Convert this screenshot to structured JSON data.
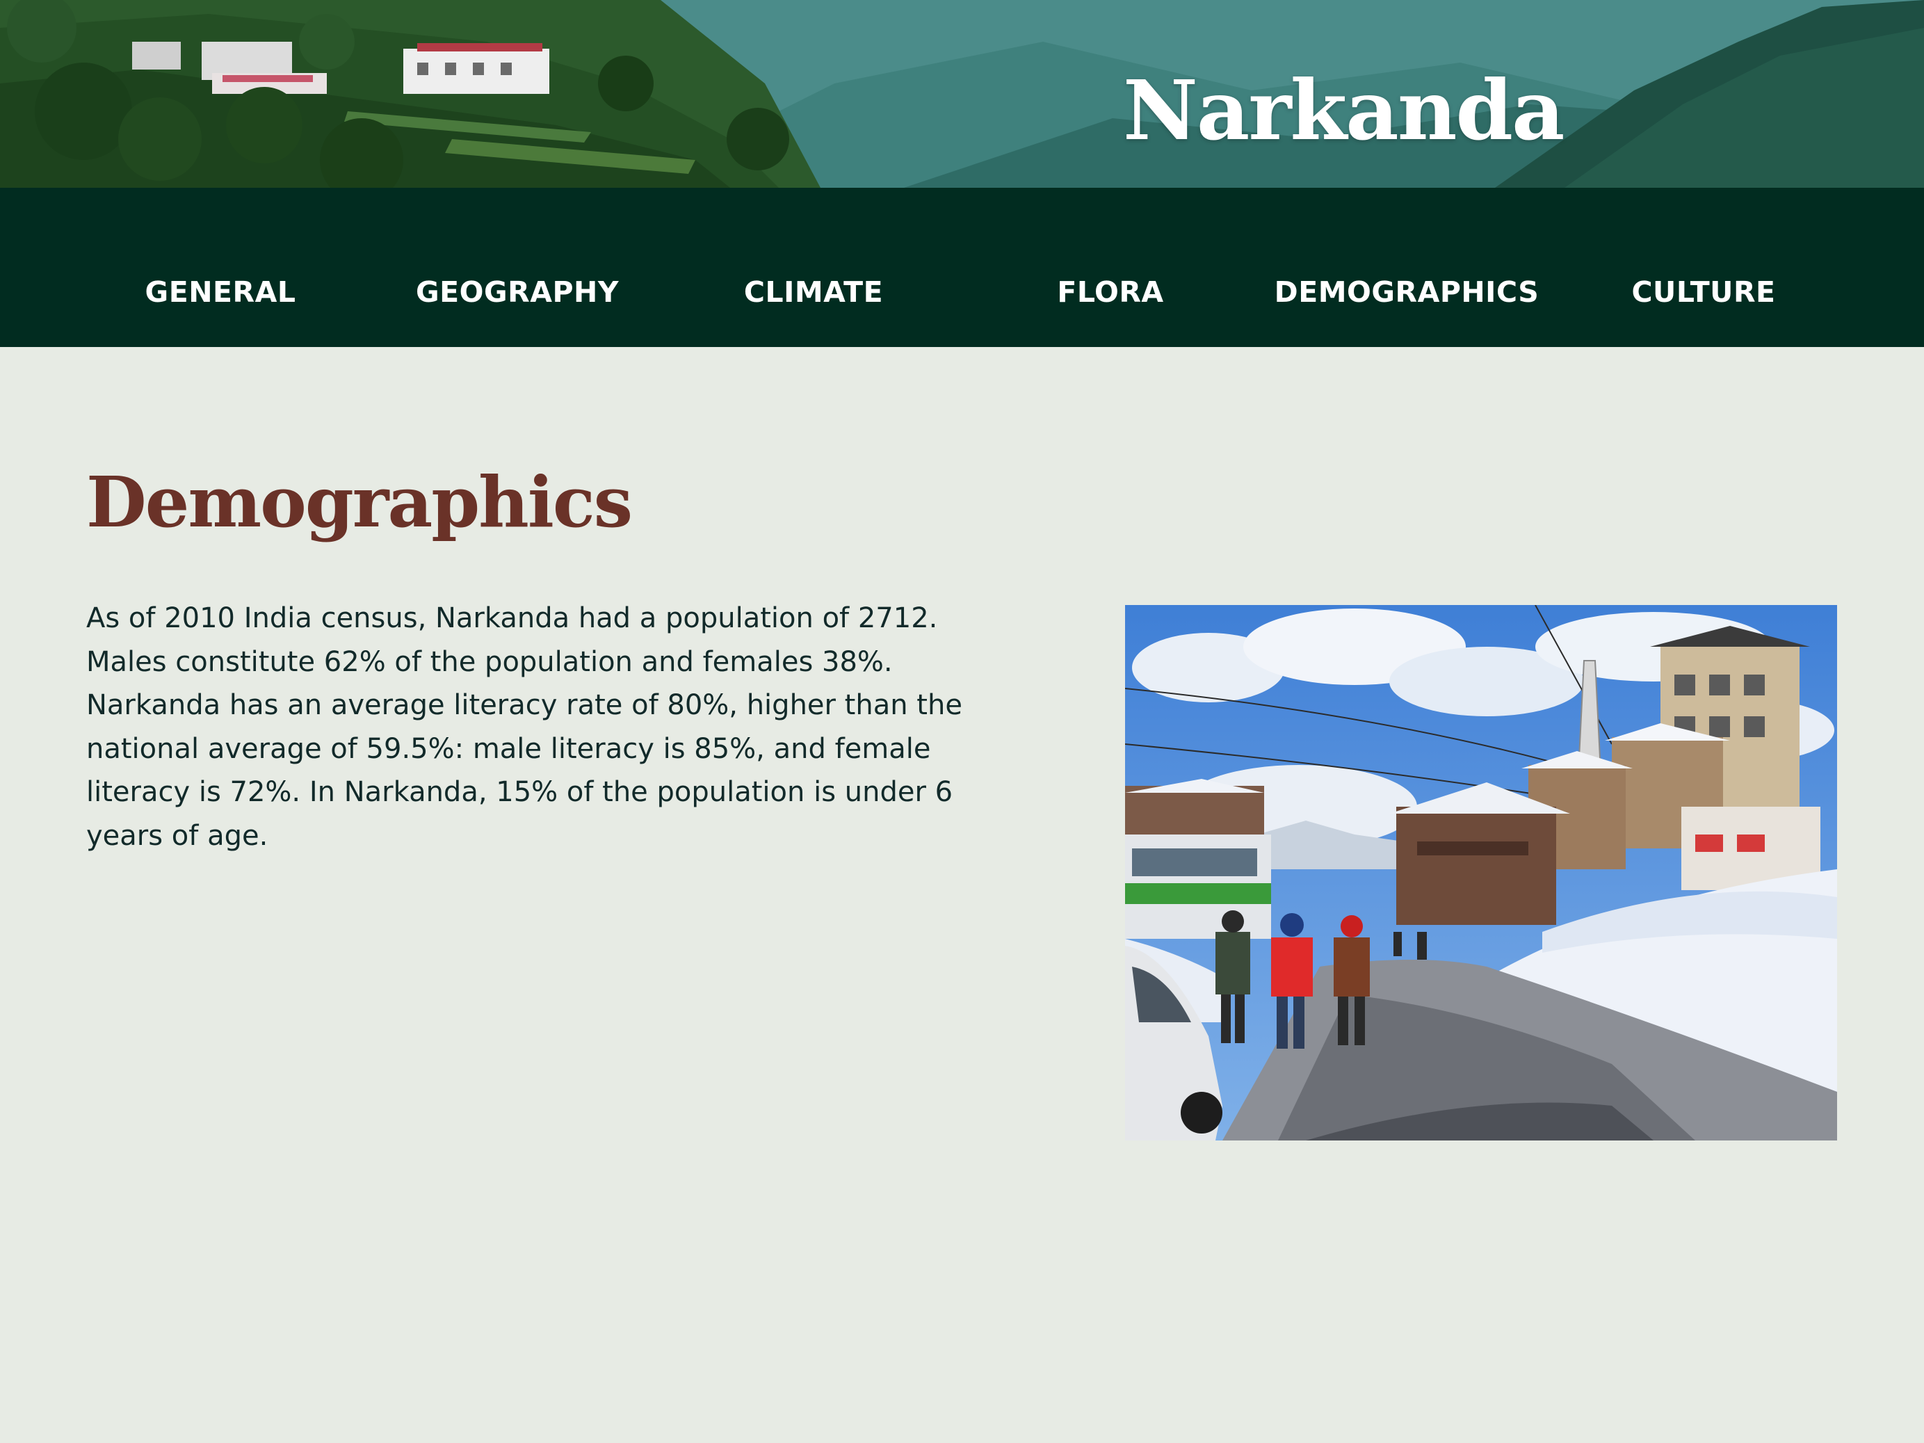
{
  "site": {
    "title": "Narkanda"
  },
  "nav": {
    "items": [
      {
        "label": "GENERAL"
      },
      {
        "label": "GEOGRAPHY"
      },
      {
        "label": "CLIMATE"
      },
      {
        "label": "FLORA"
      },
      {
        "label": "DEMOGRAPHICS"
      },
      {
        "label": "CULTURE"
      }
    ]
  },
  "section": {
    "title": "Demographics",
    "body": "As of 2010 India census, Narkanda had a population of 2712. Males constitute 62% of the population and females 38%. Narkanda has an average literacy rate of 80%, higher than the national average of 59.5%: male literacy is 85%, and female literacy is 72%. In Narkanda, 15% of the population is under 6 years of age."
  },
  "colors": {
    "nav_background": "#012c20",
    "page_background": "#e7ebe4",
    "heading": "#6a3228",
    "body_text": "#122a2a"
  },
  "icons": {
    "hero": "mountain-village-banner-image",
    "photo": "snowy-street-photo"
  }
}
